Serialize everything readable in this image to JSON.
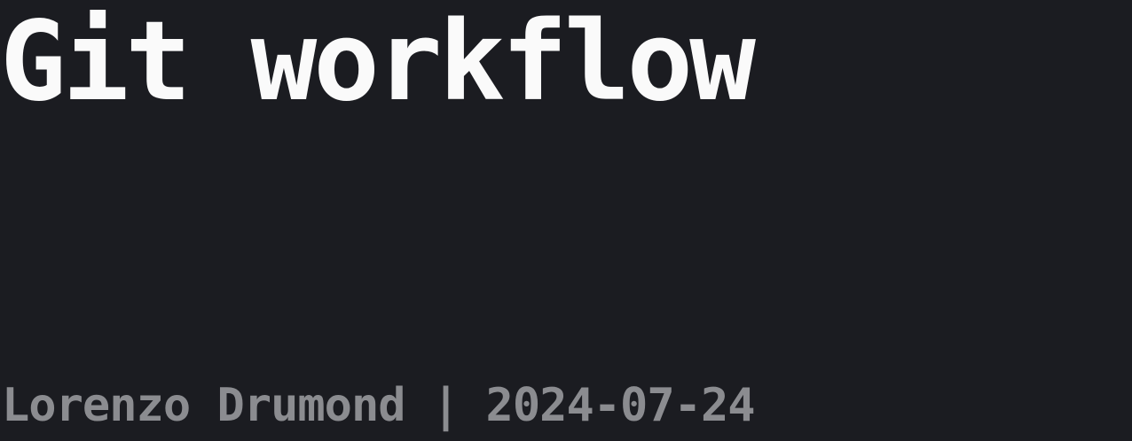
{
  "slide": {
    "title": "Git workflow",
    "byline": "Lorenzo Drumond | 2024-07-24"
  },
  "colors": {
    "background": "#1b1c21",
    "title": "#fafafa",
    "byline": "#8b8c90"
  }
}
